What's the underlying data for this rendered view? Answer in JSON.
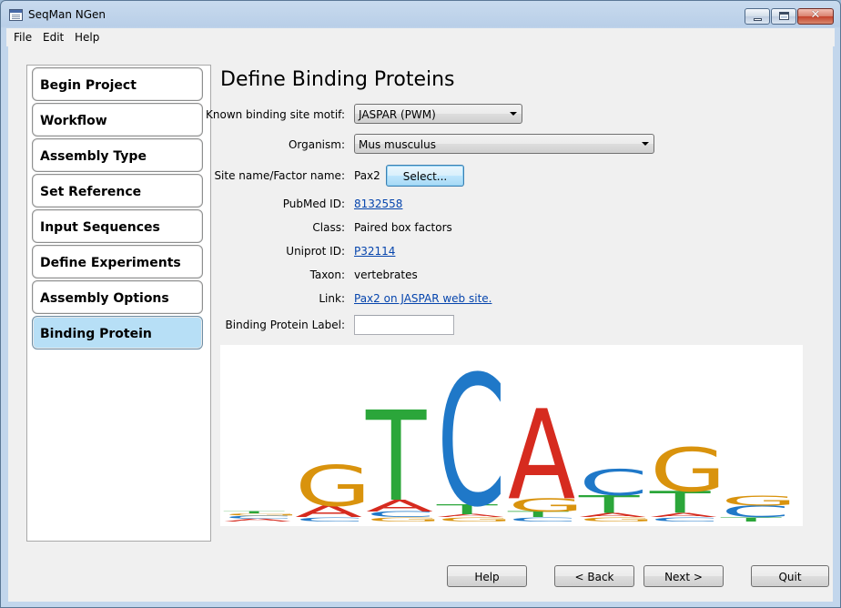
{
  "window": {
    "title": "SeqMan NGen"
  },
  "menu": [
    "File",
    "Edit",
    "Help"
  ],
  "steps": [
    {
      "label": "Begin Project",
      "active": false
    },
    {
      "label": "Workflow",
      "active": false
    },
    {
      "label": "Assembly Type",
      "active": false
    },
    {
      "label": "Set Reference",
      "active": false
    },
    {
      "label": "Input Sequences",
      "active": false
    },
    {
      "label": "Define Experiments",
      "active": false
    },
    {
      "label": "Assembly Options",
      "active": false
    },
    {
      "label": "Binding Protein",
      "active": true
    }
  ],
  "page": {
    "title": "Define Binding Proteins",
    "motif_label": "Known binding site motif:",
    "motif_value": "JASPAR (PWM)",
    "organism_label": "Organism:",
    "organism_value": "Mus musculus",
    "site_label": "Site name/Factor name:",
    "site_value": "Pax2",
    "select_label": "Select...",
    "pubmed_label": "PubMed ID:",
    "pubmed_value": "8132558",
    "class_label": "Class:",
    "class_value": "Paired box factors",
    "uniprot_label": "Uniprot ID:",
    "uniprot_value": "P32114",
    "taxon_label": "Taxon:",
    "taxon_value": "vertebrates",
    "link_label": "Link:",
    "link_value": "Pax2 on JASPAR web site.",
    "bp_label_label": "Binding Protein Label:",
    "bp_label_value": ""
  },
  "logo": {
    "colors": {
      "A": "#d62b1f",
      "C": "#1f78c8",
      "G": "#d9930d",
      "T": "#2ba63a"
    },
    "columns": [
      [
        [
          "A",
          0.02
        ],
        [
          "C",
          0.02
        ],
        [
          "G",
          0.015
        ],
        [
          "T",
          0.015
        ]
      ],
      [
        [
          "C",
          0.03
        ],
        [
          "A",
          0.08
        ],
        [
          "G",
          0.28
        ]
      ],
      [
        [
          "G",
          0.03
        ],
        [
          "C",
          0.04
        ],
        [
          "A",
          0.08
        ],
        [
          "T",
          0.62
        ]
      ],
      [
        [
          "G",
          0.03
        ],
        [
          "A",
          0.02
        ],
        [
          "T",
          0.07
        ],
        [
          "C",
          0.9
        ]
      ],
      [
        [
          "C",
          0.03
        ],
        [
          "T",
          0.04
        ],
        [
          "G",
          0.09
        ],
        [
          "A",
          0.62
        ]
      ],
      [
        [
          "G",
          0.03
        ],
        [
          "A",
          0.03
        ],
        [
          "T",
          0.12
        ],
        [
          "C",
          0.18
        ]
      ],
      [
        [
          "C",
          0.03
        ],
        [
          "A",
          0.03
        ],
        [
          "T",
          0.15
        ],
        [
          "G",
          0.3
        ]
      ],
      [
        [
          "T",
          0.03
        ],
        [
          "C",
          0.08
        ],
        [
          "G",
          0.07
        ]
      ]
    ]
  },
  "footer": {
    "help": "Help",
    "back": "< Back",
    "next": "Next >",
    "quit": "Quit"
  }
}
